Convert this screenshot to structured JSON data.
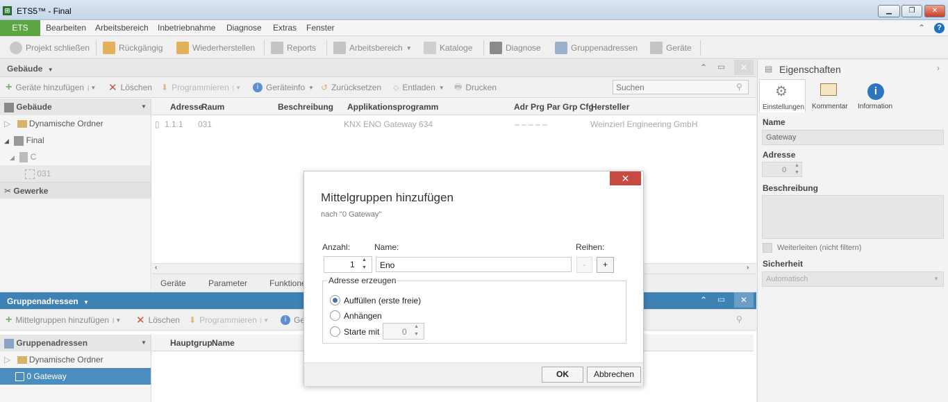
{
  "window": {
    "title": "ETS5™ - Final"
  },
  "menubar": {
    "ets_label": "ETS",
    "items": [
      "Bearbeiten",
      "Arbeitsbereich",
      "Inbetriebnahme",
      "Diagnose",
      "Extras",
      "Fenster"
    ]
  },
  "toolbar": {
    "items": [
      "Projekt schließen",
      "Rückgängig",
      "Wiederherstellen",
      "Reports",
      "Arbeitsbereich",
      "Kataloge",
      "Diagnose",
      "Gruppenadressen",
      "Geräte"
    ]
  },
  "building_panel": {
    "title": "Gebäude",
    "subtoolbar": [
      "Geräte hinzufügen",
      "Löschen",
      "Programmieren",
      "Geräteinfo",
      "Zurücksetzen",
      "Entladen",
      "Drucken"
    ],
    "search_placeholder": "Suchen",
    "tree_header": "Gebäude",
    "tree": [
      "Dynamische Ordner",
      "Final",
      "C",
      "031"
    ],
    "trades": "Gewerke",
    "columns": [
      "Adresse",
      "Raum",
      "Beschreibung",
      "Applikationsprogramm",
      "Adr Prg Par Grp Cfg",
      "Hersteller"
    ],
    "row": {
      "address": "1.1.1",
      "room": "031",
      "app": "KNX ENO Gateway 634",
      "flags": "–    –    –    –    –",
      "manufacturer": "Weinzierl Engineering GmbH"
    },
    "tabs": [
      "Geräte",
      "Parameter",
      "Funktionen"
    ]
  },
  "group_panel": {
    "title": "Gruppenadressen",
    "subtoolbar": [
      "Mittelgruppen hinzufügen",
      "Löschen",
      "Programmieren",
      "Ge"
    ],
    "tree_header": "Gruppenadressen",
    "tree": [
      "Dynamische Ordner",
      "0 Gateway"
    ],
    "columns": [
      "Hauptgrup",
      "Name"
    ]
  },
  "properties": {
    "title": "Eigenschaften",
    "tabs": [
      "Einstellungen",
      "Kommentar",
      "Information"
    ],
    "name_label": "Name",
    "name_value": "Gateway",
    "address_label": "Adresse",
    "address_value": "0",
    "description_label": "Beschreibung",
    "forward_label": "Weiterleiten (nicht filtern)",
    "security_label": "Sicherheit",
    "security_value": "Automatisch"
  },
  "dialog": {
    "title": "Mittelgruppen hinzufügen",
    "subtitle": "nach \"0 Gateway\"",
    "count_label": "Anzahl:",
    "count_value": "1",
    "name_label": "Name:",
    "name_value": "Eno",
    "rows_label": "Reihen:",
    "minus": "-",
    "plus": "+",
    "group_legend": "Adresse erzeugen",
    "options": [
      "Auffüllen (erste freie)",
      "Anhängen",
      "Starte mit"
    ],
    "start_value": "0",
    "ok": "OK",
    "cancel": "Abbrechen"
  }
}
